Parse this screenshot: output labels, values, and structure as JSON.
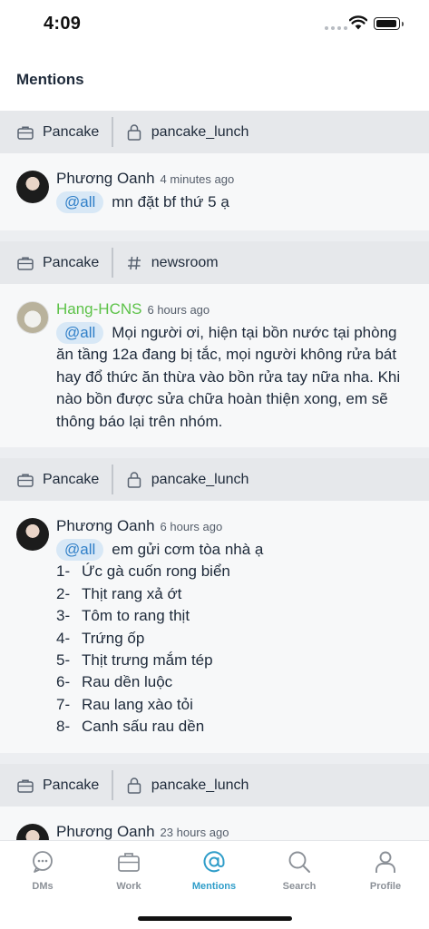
{
  "status": {
    "time": "4:09"
  },
  "header": {
    "title": "Mentions"
  },
  "mentions": [
    {
      "workspace": "Pancake",
      "channel_type": "lock",
      "channel": "pancake_lunch",
      "author": "Phương Oanh",
      "time": "4 minutes ago",
      "tag": "@all",
      "text": "mn đặt bf thứ 5 ạ"
    },
    {
      "workspace": "Pancake",
      "channel_type": "hash",
      "channel": "newsroom",
      "author": "Hang-HCNS",
      "time": "6 hours ago",
      "tag": "@all",
      "text": "Mọi người ơi, hiện tại bồn nước tại phòng ăn tầng 12a đang bị tắc, mọi người không rửa bát hay đổ thức ăn thừa vào bồn rửa tay nữa nha. Khi nào bồn được sửa chữa hoàn thiện xong, em sẽ thông báo lại trên nhóm."
    },
    {
      "workspace": "Pancake",
      "channel_type": "lock",
      "channel": "pancake_lunch",
      "author": "Phương Oanh",
      "time": "6 hours ago",
      "tag": "@all",
      "text": "em gửi cơm tòa nhà ạ",
      "list": [
        {
          "num": "1-",
          "item": "Ức gà cuốn rong biển"
        },
        {
          "num": "2-",
          "item": "Thịt rang xả ớt"
        },
        {
          "num": "3-",
          "item": "Tôm to rang thịt"
        },
        {
          "num": "4-",
          "item": "Trứng ốp"
        },
        {
          "num": "5-",
          "item": "Thịt trưng mắm tép"
        },
        {
          "num": "6-",
          "item": "Rau dền luộc"
        },
        {
          "num": "7-",
          "item": "Rau lang xào tỏi"
        },
        {
          "num": "8-",
          "item": "Canh sấu rau dền"
        }
      ]
    },
    {
      "workspace": "Pancake",
      "channel_type": "lock",
      "channel": "pancake_lunch",
      "author": "Phương Oanh",
      "time": "23 hours ago"
    }
  ],
  "tabs": [
    {
      "label": "DMs",
      "icon": "chat-bubble-icon"
    },
    {
      "label": "Work",
      "icon": "briefcase-icon"
    },
    {
      "label": "Mentions",
      "icon": "at-sign-icon",
      "active": true
    },
    {
      "label": "Search",
      "icon": "search-icon"
    },
    {
      "label": "Profile",
      "icon": "person-icon"
    }
  ],
  "colors": {
    "accent": "#2f9dc9",
    "tag_bg": "#d8e8f6",
    "tag_text": "#2f7fc8",
    "bot_name": "#5cc248"
  }
}
